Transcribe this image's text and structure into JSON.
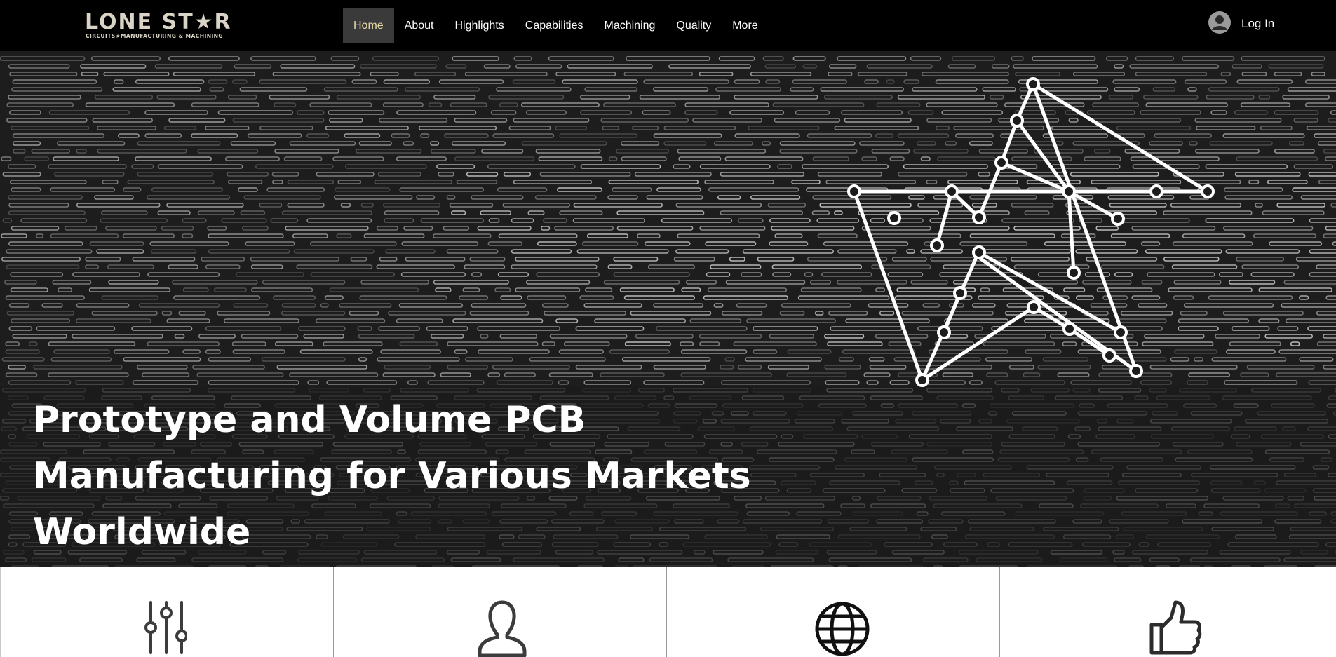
{
  "header": {
    "logo": {
      "title": "LONE ST★R",
      "subtitle": "CIRCUITS★MANUFACTURING & MACHINING",
      "color": "#d9d4c6"
    },
    "nav": [
      {
        "label": "Home",
        "active": true
      },
      {
        "label": "About"
      },
      {
        "label": "Highlights"
      },
      {
        "label": "Capabilities"
      },
      {
        "label": "Machining"
      },
      {
        "label": "Quality"
      },
      {
        "label": "More"
      }
    ],
    "login": {
      "label": "Log In",
      "icon": "user-avatar-icon"
    }
  },
  "hero": {
    "title": "Prototype and Volume PCB Manufacturing for Various Markets Worldwide",
    "graphic": "circuit-star-icon",
    "background": "pcb-trace-pattern"
  },
  "features": [
    {
      "icon": "sliders-icon"
    },
    {
      "icon": "user-icon"
    },
    {
      "icon": "globe-icon"
    },
    {
      "icon": "thumbs-up-icon"
    }
  ],
  "colors": {
    "header_bg": "#000000",
    "nav_active_bg": "#3a3a3a",
    "nav_active_text": "#e8d9a8",
    "nav_text": "#ffffff",
    "hero_text": "#ffffff",
    "icon_stroke": "#3c3c3c"
  }
}
